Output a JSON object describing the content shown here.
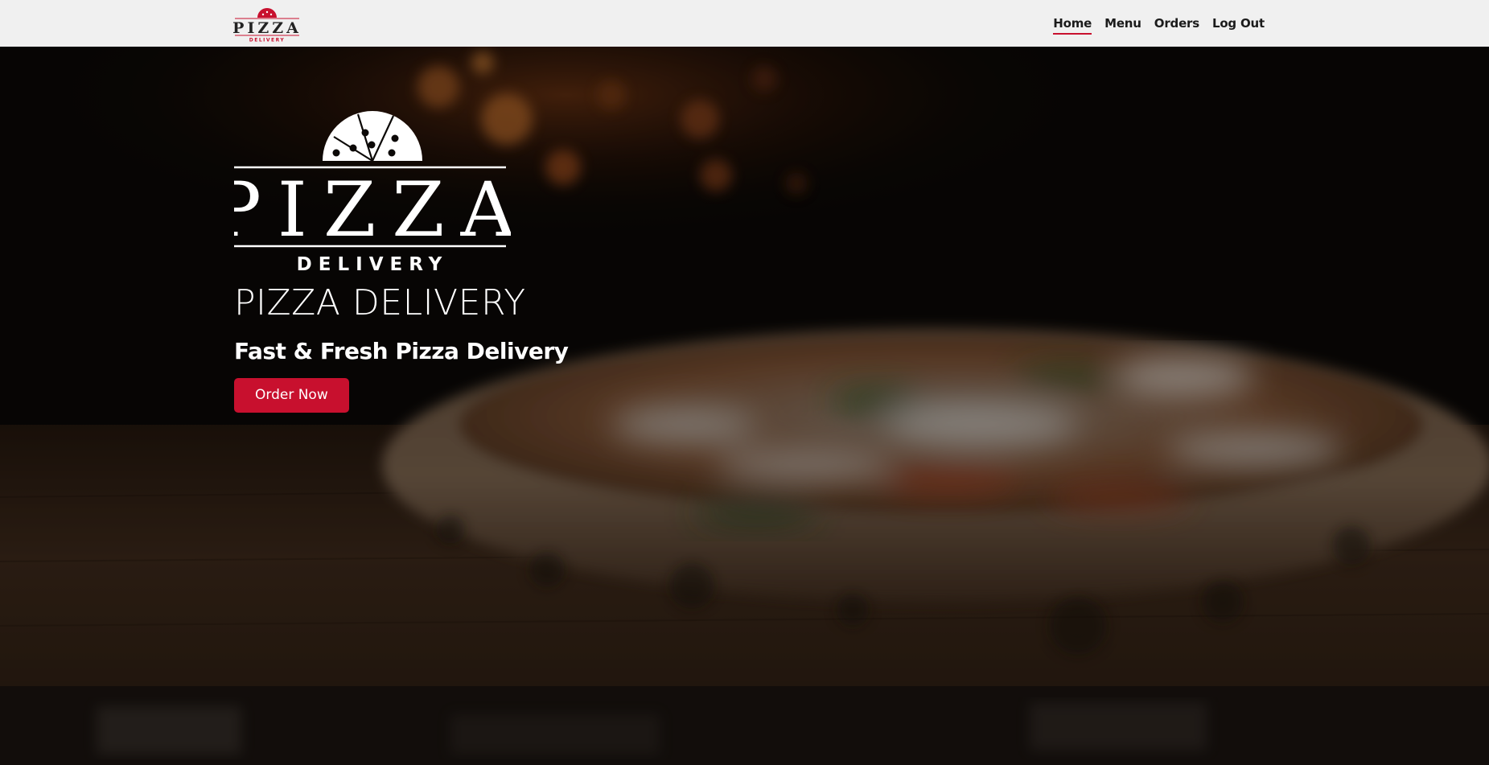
{
  "brand": {
    "logo_word": "PIZZA",
    "logo_tagline": "DELIVERY",
    "accent_color": "#c8102e"
  },
  "nav": {
    "items": [
      {
        "label": "Home",
        "active": true
      },
      {
        "label": "Menu",
        "active": false
      },
      {
        "label": "Orders",
        "active": false
      },
      {
        "label": "Log Out",
        "active": false
      }
    ]
  },
  "hero": {
    "title": "PIZZA DELIVERY",
    "subtitle": "Fast & Fresh Pizza Delivery",
    "cta_label": "Order Now",
    "background_image": "pizza-on-wooden-board-photo"
  }
}
